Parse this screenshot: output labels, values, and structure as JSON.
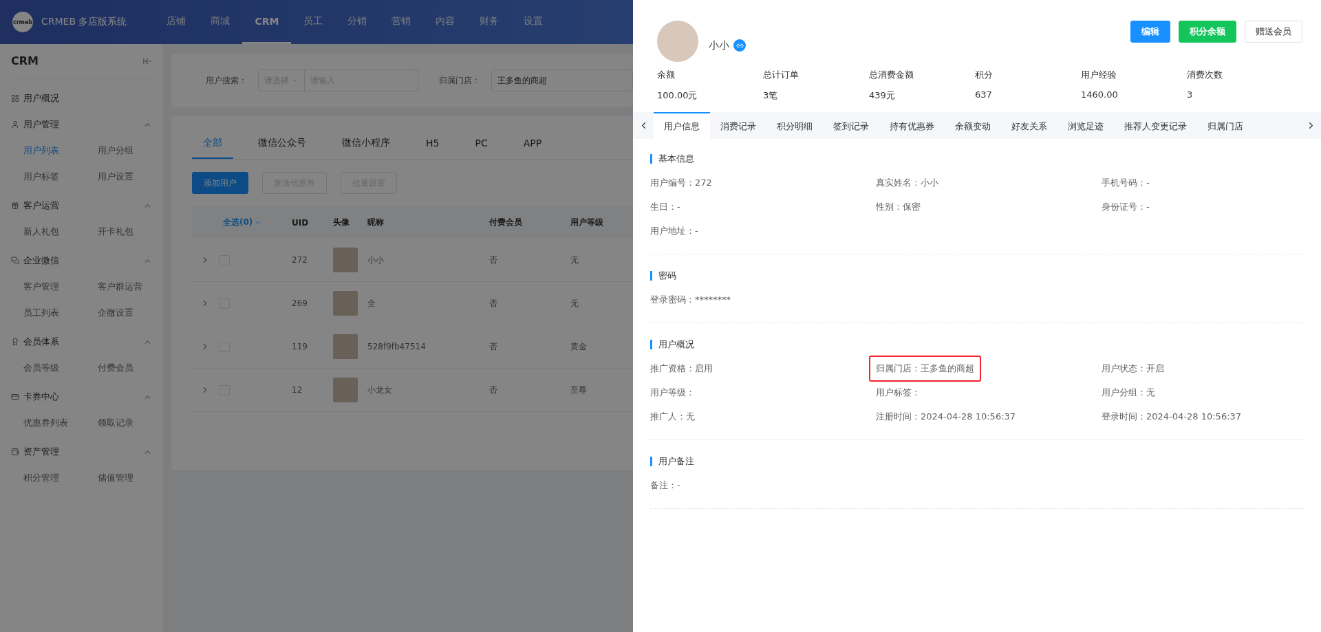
{
  "header": {
    "logo_text": "crmeb",
    "brand": "CRMEB 多店版系统",
    "nav": [
      {
        "label": "店铺",
        "selected": false
      },
      {
        "label": "商城",
        "selected": false
      },
      {
        "label": "CRM",
        "selected": true
      },
      {
        "label": "员工",
        "selected": false
      },
      {
        "label": "分销",
        "selected": false
      },
      {
        "label": "营销",
        "selected": false
      },
      {
        "label": "内容",
        "selected": false
      },
      {
        "label": "财务",
        "selected": false
      },
      {
        "label": "设置",
        "selected": false
      }
    ]
  },
  "sidebar": {
    "title": "CRM",
    "groups": [
      {
        "title": "用户概况"
      },
      {
        "title": "用户管理",
        "expanded": true,
        "items": [
          {
            "label": "用户列表",
            "selected": true
          },
          {
            "label": "用户分组",
            "selected": false
          },
          {
            "label": "用户标签",
            "selected": false
          },
          {
            "label": "用户设置",
            "selected": false
          }
        ]
      },
      {
        "title": "客户运营",
        "expanded": true,
        "items": [
          {
            "label": "新人礼包",
            "selected": false
          },
          {
            "label": "开卡礼包",
            "selected": false
          }
        ]
      },
      {
        "title": "企业微信",
        "expanded": true,
        "items": [
          {
            "label": "客户管理",
            "selected": false
          },
          {
            "label": "客户群运营",
            "selected": false
          },
          {
            "label": "员工列表",
            "selected": false
          },
          {
            "label": "企微设置",
            "selected": false
          }
        ]
      },
      {
        "title": "会员体系",
        "expanded": true,
        "items": [
          {
            "label": "会员等级",
            "selected": false
          },
          {
            "label": "付费会员",
            "selected": false
          }
        ]
      },
      {
        "title": "卡券中心",
        "expanded": true,
        "items": [
          {
            "label": "优惠券列表",
            "selected": false
          },
          {
            "label": "领取记录",
            "selected": false
          }
        ]
      },
      {
        "title": "资产管理",
        "expanded": true,
        "items": [
          {
            "label": "积分管理",
            "selected": false
          },
          {
            "label": "储值管理",
            "selected": false
          }
        ]
      }
    ]
  },
  "search": {
    "label": "用户搜索：",
    "select_placeholder": "请选择",
    "input_placeholder": "请输入",
    "store_label": "归属门店：",
    "store_value": "王多鱼的商超"
  },
  "list": {
    "tabs": [
      {
        "label": "全部",
        "selected": true
      },
      {
        "label": "微信公众号",
        "selected": false
      },
      {
        "label": "微信小程序",
        "selected": false
      },
      {
        "label": "H5",
        "selected": false
      },
      {
        "label": "PC",
        "selected": false
      },
      {
        "label": "APP",
        "selected": false
      }
    ],
    "buttons": [
      {
        "label": "添加用户",
        "disabled": false
      },
      {
        "label": "发送优惠券",
        "disabled": true
      },
      {
        "label": "批量设置",
        "disabled": true
      }
    ],
    "table": {
      "select_all": "全选(0)",
      "columns": [
        "UID",
        "头像",
        "昵称",
        "付费会员",
        "用户等级"
      ],
      "rows": [
        {
          "uid": "272",
          "nickname": "小小",
          "paid": "否",
          "level": "无",
          "checked": false
        },
        {
          "uid": "269",
          "nickname": "全",
          "paid": "否",
          "level": "无",
          "checked": false
        },
        {
          "uid": "119",
          "nickname": "528f9fb47514",
          "paid": "否",
          "level": "黄金",
          "checked": false
        },
        {
          "uid": "12",
          "nickname": "小龙女",
          "paid": "否",
          "level": "至尊",
          "checked": false
        }
      ]
    }
  },
  "drawer": {
    "name": "小小",
    "buttons": [
      {
        "label": "编辑",
        "kind": "primary"
      },
      {
        "label": "积分余额",
        "kind": "success"
      },
      {
        "label": "赠送会员",
        "kind": "default"
      }
    ],
    "stats": [
      {
        "label": "余额",
        "value": "100.00元"
      },
      {
        "label": "总计订单",
        "value": "3笔"
      },
      {
        "label": "总消费金额",
        "value": "439元"
      },
      {
        "label": "积分",
        "value": "637"
      },
      {
        "label": "用户经验",
        "value": "1460.00"
      },
      {
        "label": "消费次数",
        "value": "3"
      }
    ],
    "tabs": [
      {
        "label": "用户信息",
        "selected": true
      },
      {
        "label": "消费记录",
        "selected": false
      },
      {
        "label": "积分明细",
        "selected": false
      },
      {
        "label": "签到记录",
        "selected": false
      },
      {
        "label": "持有优惠券",
        "selected": false
      },
      {
        "label": "余额变动",
        "selected": false
      },
      {
        "label": "好友关系",
        "selected": false
      },
      {
        "label": "浏览足迹",
        "selected": false
      },
      {
        "label": "推荐人变更记录",
        "selected": false
      },
      {
        "label": "归属门店",
        "selected": false
      }
    ],
    "sections": [
      {
        "title": "基本信息",
        "fields": [
          {
            "text": "用户编号：272",
            "highlighted": false
          },
          {
            "text": "真实姓名：小小",
            "highlighted": false
          },
          {
            "text": "手机号码：-",
            "highlighted": false
          },
          {
            "text": "生日：-",
            "highlighted": false
          },
          {
            "text": "性别：保密",
            "highlighted": false
          },
          {
            "text": "身份证号：-",
            "highlighted": false
          },
          {
            "text": "用户地址：-",
            "highlighted": false
          }
        ]
      },
      {
        "title": "密码",
        "fields": [
          {
            "text": "登录密码：********",
            "highlighted": false
          }
        ]
      },
      {
        "title": "用户概况",
        "fields": [
          {
            "text": "推广资格：启用",
            "highlighted": false
          },
          {
            "text": "归属门店：王多鱼的商超",
            "highlighted": true
          },
          {
            "text": "用户状态：开启",
            "highlighted": false
          },
          {
            "text": "用户等级：",
            "highlighted": false
          },
          {
            "text": "用户标签：",
            "highlighted": false
          },
          {
            "text": "用户分组：无",
            "highlighted": false
          },
          {
            "text": "推广人：无",
            "highlighted": false
          },
          {
            "text": "注册时间：2024-04-28 10:56:37",
            "highlighted": false
          },
          {
            "text": "登录时间：2024-04-28 10:56:37",
            "highlighted": false
          }
        ]
      },
      {
        "title": "用户备注",
        "fields": [
          {
            "text": "备注：-",
            "highlighted": false
          }
        ]
      }
    ]
  }
}
